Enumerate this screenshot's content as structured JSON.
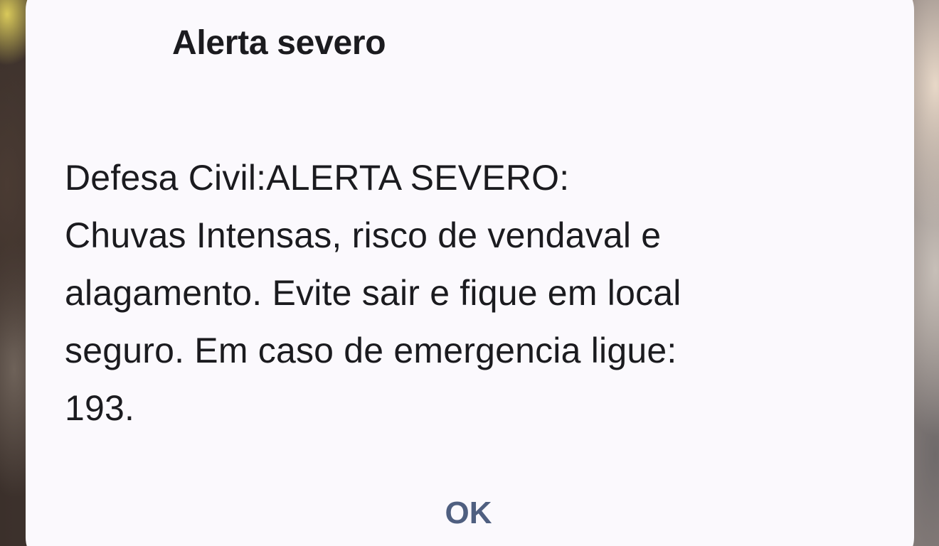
{
  "dialog": {
    "title": "Alerta severo",
    "message": "Defesa Civil:ALERTA SEVERO:\nChuvas Intensas, risco de vendaval e\nalagamento. Evite sair e fique em local\nseguro. Em caso de emergencia ligue:\n193.",
    "ok_label": "OK"
  },
  "colors": {
    "dialog_background": "#fbf9fd",
    "text": "#1b1b1f",
    "button_text": "#4f5f80"
  }
}
